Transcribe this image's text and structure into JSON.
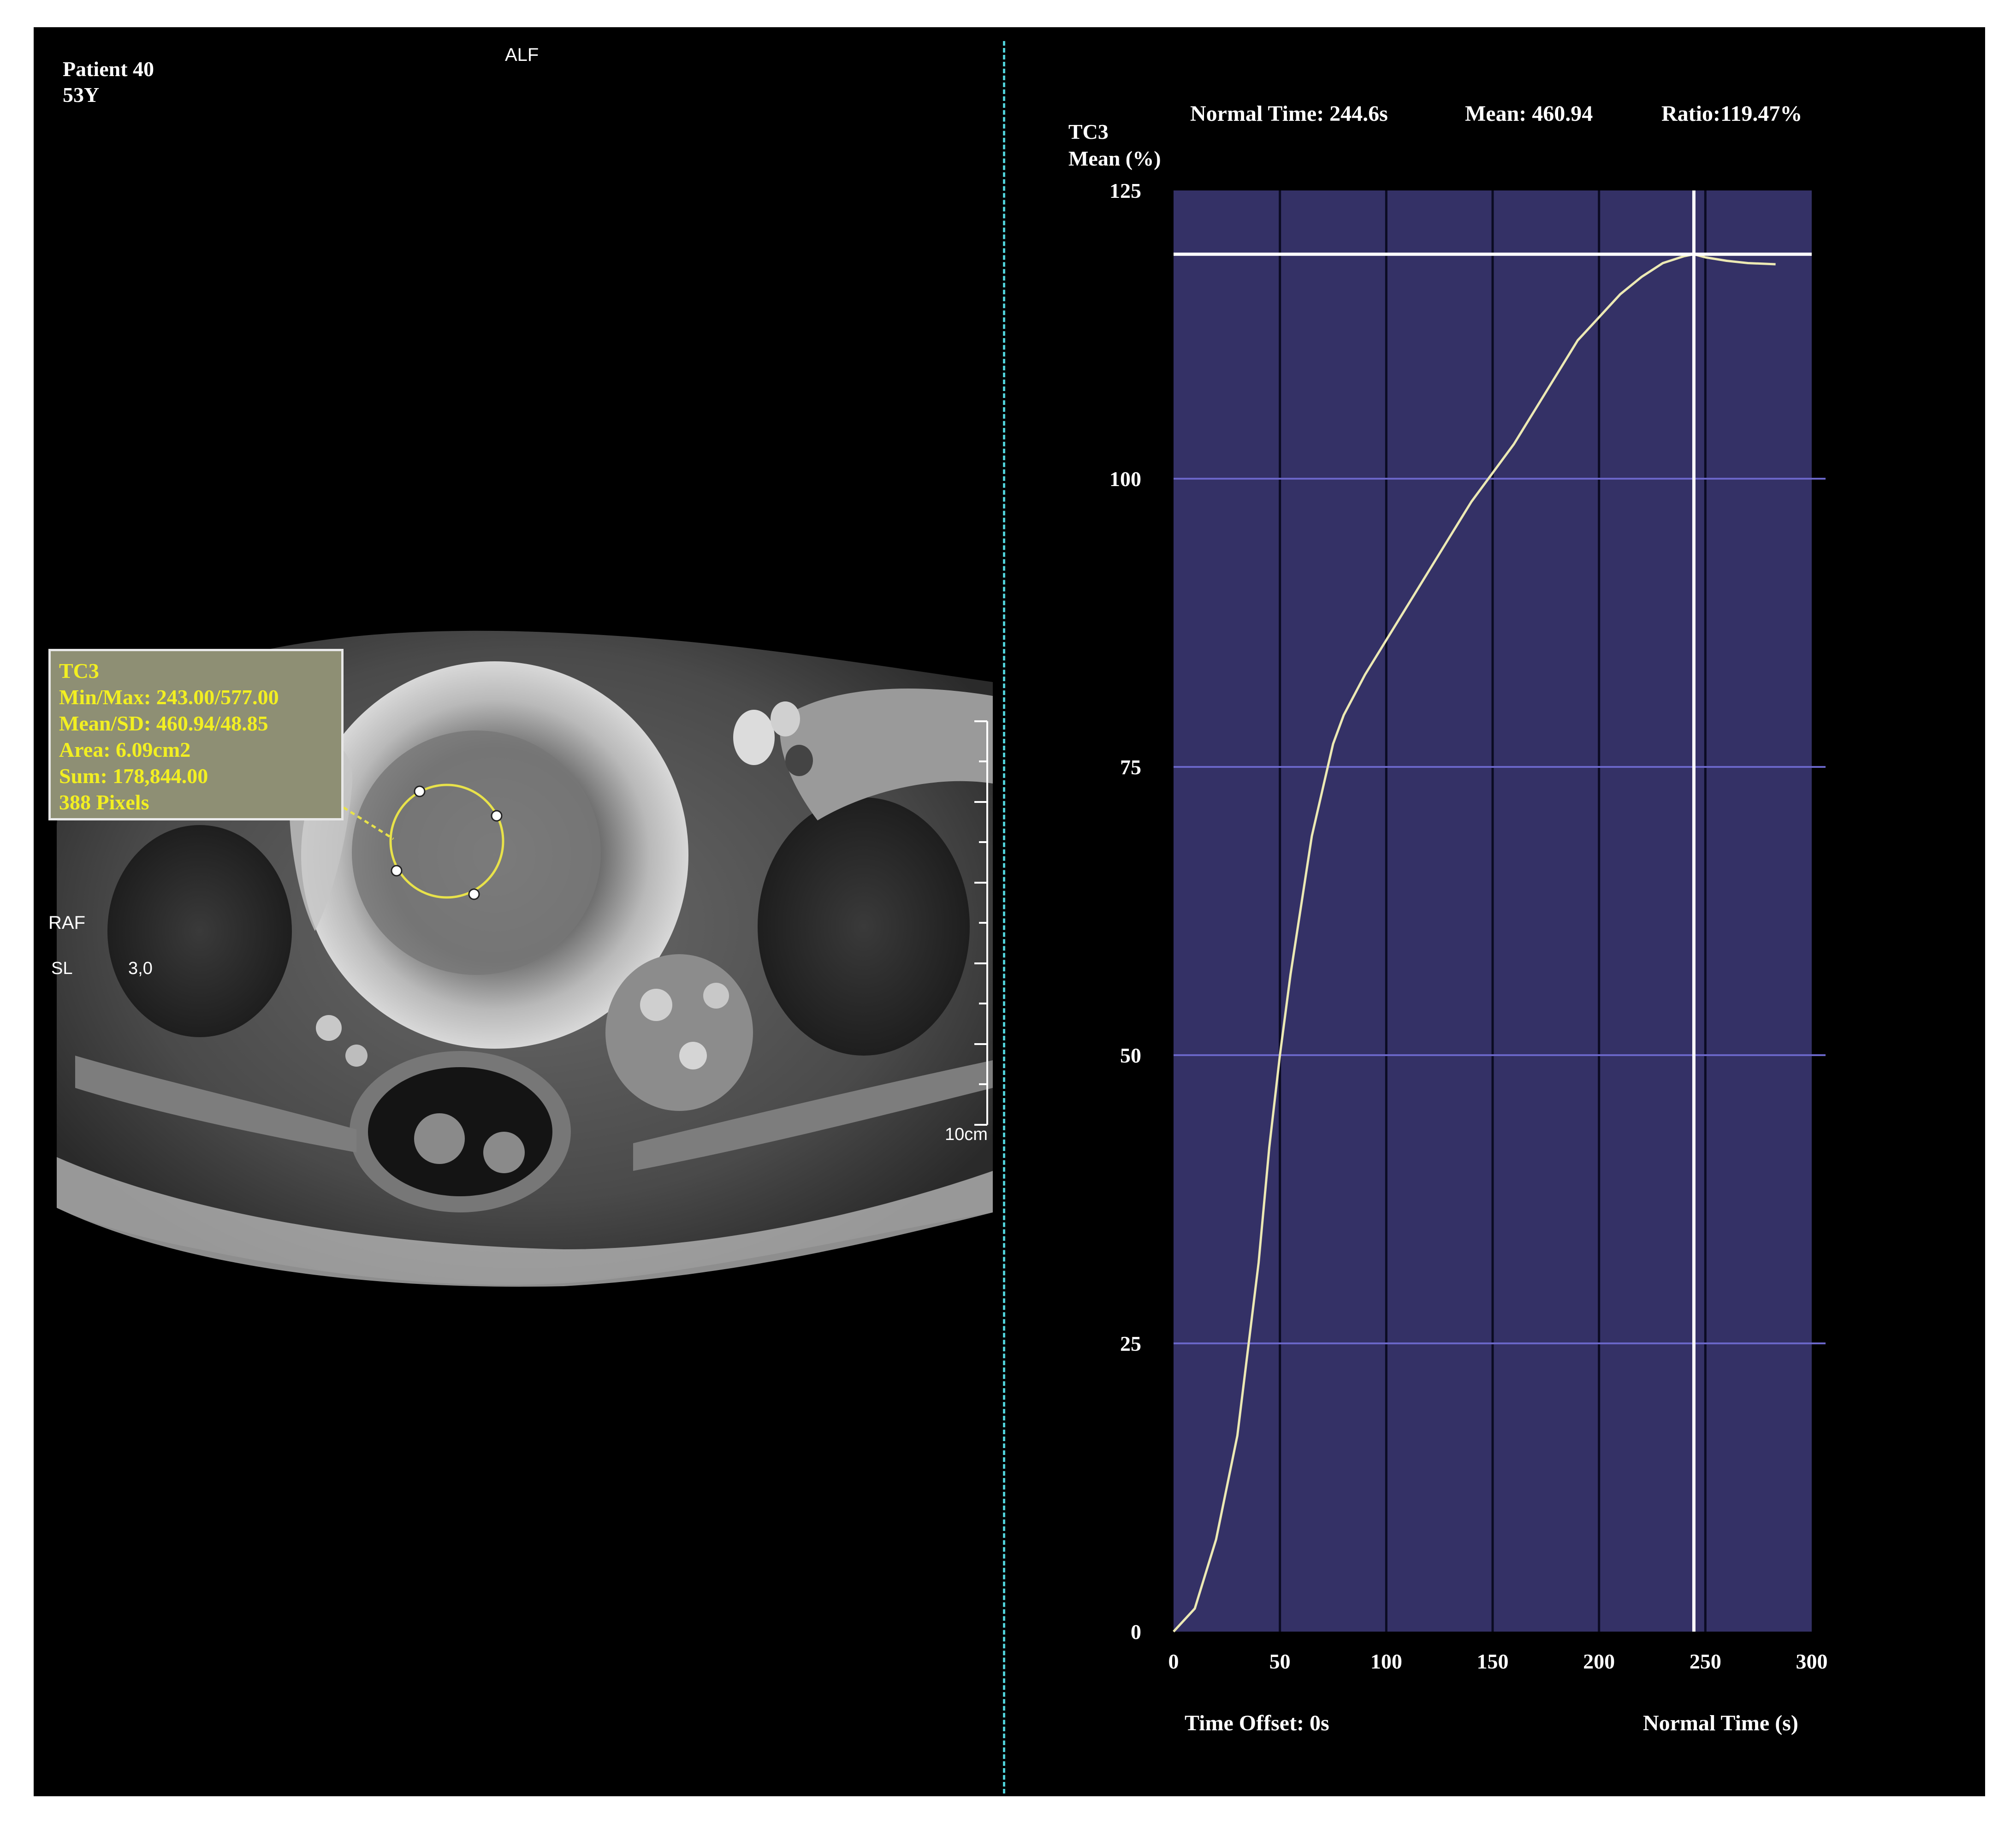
{
  "left_panel": {
    "patient_label": "Patient 40",
    "age_label": "53Y",
    "orientation_top": "ALF",
    "orientation_left": "RAF",
    "slice_label": "SL",
    "slice_value": "3,0",
    "scale_label": "10cm",
    "roi_box": {
      "name": "TC3",
      "min_max": "Min/Max: 243.00/577.00",
      "mean_sd": "Mean/SD: 460.94/48.85",
      "area": "Area: 6.09cm2",
      "sum": "Sum: 178,844.00",
      "pixels": "388 Pixels"
    }
  },
  "right_panel": {
    "normal_time": "Normal Time: 244.6s",
    "mean": "Mean: 460.94",
    "ratio": "Ratio:119.47%",
    "time_offset": "Time Offset: 0s"
  },
  "chart_data": {
    "type": "line",
    "ylabel_line1": "TC3",
    "ylabel_line2": "Mean (%)",
    "xlabel": "Normal Time (s)",
    "xlim": [
      0,
      300
    ],
    "ylim": [
      0,
      125
    ],
    "xticks": [
      "0",
      "50",
      "100",
      "150",
      "200",
      "250",
      "300"
    ],
    "yticks": [
      "0",
      "25",
      "50",
      "75",
      "100",
      "125"
    ],
    "grid": true,
    "background": "#343166",
    "line_color": "#ece9b4",
    "cursor": {
      "x": 244.6,
      "y": 119.47
    },
    "series": [
      {
        "x": [
          0,
          10,
          20,
          30,
          40,
          45,
          50,
          55,
          60,
          65,
          70,
          75,
          80,
          90,
          100,
          110,
          120,
          130,
          140,
          150,
          160,
          170,
          180,
          190,
          200,
          210,
          220,
          230,
          240,
          244.6,
          250,
          260,
          270,
          283
        ],
        "y": [
          0,
          2,
          8,
          17,
          32,
          42,
          50,
          57,
          63,
          69,
          73,
          77,
          79.5,
          83,
          86,
          89,
          92,
          95,
          98,
          100.5,
          103,
          106,
          109,
          112,
          114,
          116,
          117.5,
          118.7,
          119.3,
          119.47,
          119.2,
          118.9,
          118.7,
          118.6
        ]
      }
    ]
  }
}
